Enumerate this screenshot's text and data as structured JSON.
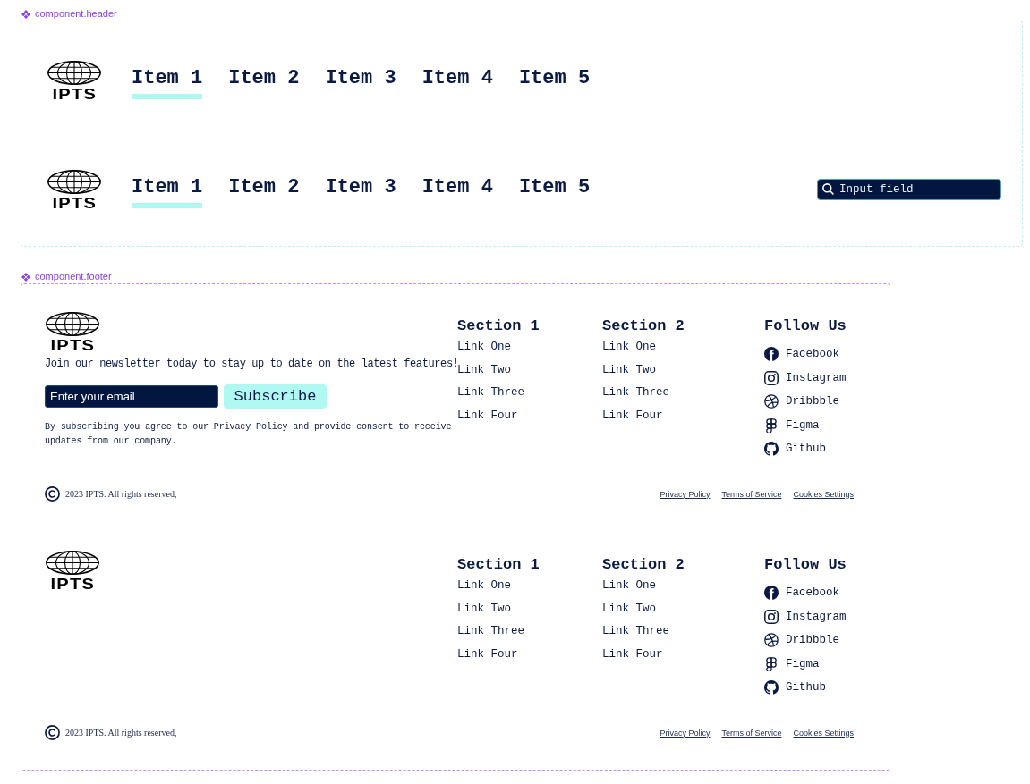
{
  "header_frame": {
    "label": "component.header",
    "variants": [
      {
        "logo": "IPTS",
        "nav": [
          {
            "label": "Item 1",
            "selected": true
          },
          {
            "label": "Item 2",
            "selected": false
          },
          {
            "label": "Item 3",
            "selected": false
          },
          {
            "label": "Item 4",
            "selected": false
          },
          {
            "label": "Item 5",
            "selected": false
          }
        ]
      },
      {
        "logo": "IPTS",
        "nav": [
          {
            "label": "Item 1",
            "selected": true
          },
          {
            "label": "Item 2",
            "selected": false
          },
          {
            "label": "Item 3",
            "selected": false
          },
          {
            "label": "Item 4",
            "selected": false
          },
          {
            "label": "Item 5",
            "selected": false
          }
        ],
        "search": {
          "placeholder": "Input field"
        }
      }
    ]
  },
  "footer_frame": {
    "label": "component.footer",
    "variants": [
      {
        "logo": "IPTS",
        "newsletter": {
          "text": "Join our newsletter today to stay up to date on the latest features!",
          "email_placeholder": "Enter your email",
          "button": "Subscribe",
          "disclaimer": "By subscribing you agree to our Privacy Policy and provide consent to receive updates from our company."
        },
        "columns": [
          {
            "title": "Section 1",
            "links": [
              "Link One",
              "Link Two",
              "Link Three",
              "Link Four"
            ]
          },
          {
            "title": "Section 2",
            "links": [
              "Link One",
              "Link Two",
              "Link Three",
              "Link Four"
            ]
          }
        ],
        "social": {
          "title": "Follow Us",
          "items": [
            {
              "kind": "facebook",
              "label": "Facebook"
            },
            {
              "kind": "instagram",
              "label": "Instagram"
            },
            {
              "kind": "dribbble",
              "label": "Dribbble"
            },
            {
              "kind": "figma",
              "label": "Figma"
            },
            {
              "kind": "github",
              "label": "Github"
            }
          ]
        },
        "copyright": "2023 IPTS. All rights reserved,",
        "legal_links": [
          "Privacy Policy",
          "Terms of Service",
          "Cookies Settings"
        ]
      },
      {
        "logo": "IPTS",
        "columns": [
          {
            "title": "Section 1",
            "links": [
              "Link One",
              "Link Two",
              "Link Three",
              "Link Four"
            ]
          },
          {
            "title": "Section 2",
            "links": [
              "Link One",
              "Link Two",
              "Link Three",
              "Link Four"
            ]
          }
        ],
        "social": {
          "title": "Follow Us",
          "items": [
            {
              "kind": "facebook",
              "label": "Facebook"
            },
            {
              "kind": "instagram",
              "label": "Instagram"
            },
            {
              "kind": "dribbble",
              "label": "Dribbble"
            },
            {
              "kind": "figma",
              "label": "Figma"
            },
            {
              "kind": "github",
              "label": "Github"
            }
          ]
        },
        "copyright": "2023 IPTS. All rights reserved,",
        "legal_links": [
          "Privacy Policy",
          "Terms of Service",
          "Cookies Settings"
        ]
      }
    ]
  }
}
